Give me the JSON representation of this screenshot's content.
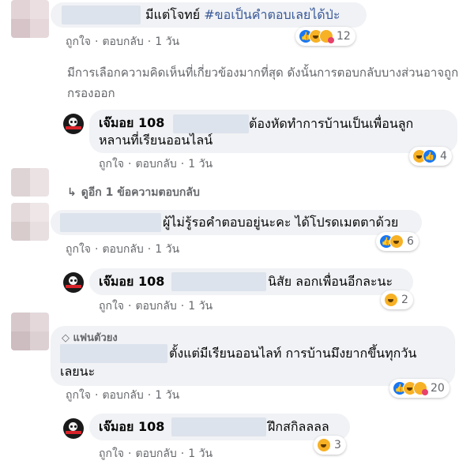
{
  "actions": {
    "like": "ถูกใจ",
    "reply": "ตอบกลับ",
    "separator": "·"
  },
  "notice": "มีการเลือกความคิดเห็นที่เกี่ยวข้องมากที่สุด ดังนั้นการตอบกลับบางส่วนอาจถูกกรองออก",
  "view_more_replies": "ดูอีก 1 ข้อความตอบกลับ",
  "fan_badge": "แฟนตัวยง",
  "colors": {
    "bubble": "#f0f2f5",
    "link": "#385898",
    "muted": "#65676b",
    "like_blue": "#1877f2",
    "haha_yellow": "#f7b125",
    "care_pink": "#e8416b"
  },
  "comments": [
    {
      "text_before": "มีแต่โจทย์ ",
      "hashtag": "#ขอเป็นคำตอบเลยได้ป่ะ",
      "time": "1 วัน",
      "reactions": {
        "icons": [
          "like-icon",
          "haha-icon",
          "care-icon"
        ],
        "count": "12"
      },
      "reply": {
        "name": "เจ๊มอย 108",
        "text_line1": "ต้องหัดทำการบ้านเป็นเพื่อนลูก",
        "text_line2": "หลานที่เรียนออนไลน์",
        "time": "1 วัน",
        "reactions": {
          "icons": [
            "haha-icon",
            "like-icon"
          ],
          "count": "4"
        }
      }
    },
    {
      "text": "ผู้ไม่รู้รอคำตอบอยู่นะคะ ได้โปรดเมตตาด้วย",
      "time": "1 วัน",
      "reactions": {
        "icons": [
          "like-icon",
          "haha-icon"
        ],
        "count": "6"
      },
      "reply": {
        "name": "เจ๊มอย 108",
        "text": "นิสัย ลอกเพื่อนอีกละนะ",
        "time": "1 วัน",
        "reactions": {
          "icons": [
            "haha-icon"
          ],
          "count": "2"
        }
      }
    },
    {
      "text_line1": "ตั้งแต่มีเรียนออนไลท์ การบ้านมึงยากขึ้นทุกวัน",
      "text_line2": "เลยนะ",
      "time": "1 วัน",
      "reactions": {
        "icons": [
          "like-icon",
          "haha-icon",
          "care-icon"
        ],
        "count": "20"
      },
      "reply": {
        "name": "เจ๊มอย 108",
        "text": "ฝึกสกิลลลล",
        "time": "1 วัน",
        "reactions": {
          "icons": [
            "haha-icon"
          ],
          "count": "3"
        }
      }
    }
  ]
}
